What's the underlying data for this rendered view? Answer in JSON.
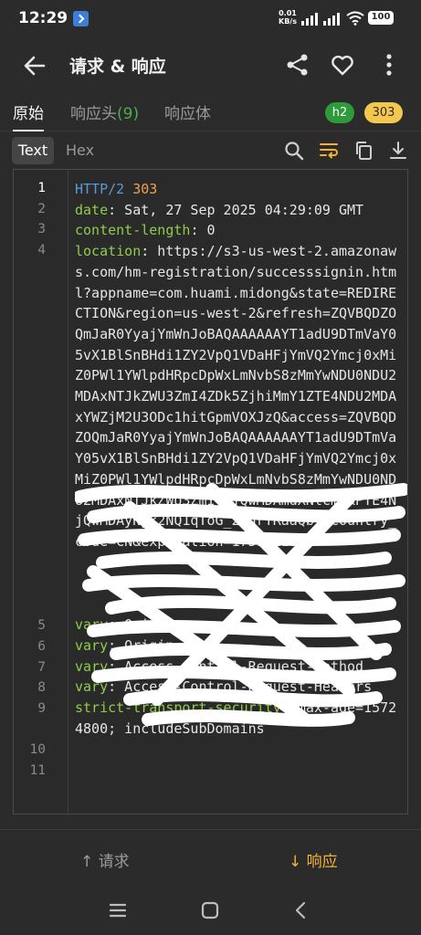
{
  "status": {
    "time": "12:29",
    "net_speed_top": "0.01",
    "net_speed_bottom": "KB/s",
    "battery": "100"
  },
  "app_bar": {
    "title": "请求 & 响应"
  },
  "tabs": {
    "raw": "原始",
    "headers": "响应头",
    "headers_count": "(9)",
    "body": "响应体"
  },
  "badges": {
    "protocol": "h2",
    "status_code": "303"
  },
  "view_modes": {
    "text": "Text",
    "hex": "Hex"
  },
  "code": {
    "line_numbers": [
      "1",
      "2",
      "3",
      "4",
      "5",
      "6",
      "7",
      "8",
      "9",
      "10",
      "11"
    ],
    "line1_protocol": "HTTP/2",
    "line1_status": "303",
    "line2_key": "date",
    "line2_value": " Sat, 27 Sep 2025 04:29:09 GMT",
    "line3_key": "content-length",
    "line3_value": " 0",
    "line4_key": "location",
    "line4_value": " https://s3-us-west-2.amazonaws.com/hm-registration/successsignin.html?appname=com.huami.midong&state=REDIRECTION&region=us-west-2&refresh=ZQVBQDZOQmJaR0YyajYmWnJoBAQAAAAAAYT1adU9DTmVaY05vX1BlSnBHdi1ZY2VpQ1VDaHFjYmVQ2Ymcj0xMiZ0PWl1YWlpdHRpcDpWxLmNvbS8zMmYwNDU0NDU2MDAxNTJkZWU3ZmI4ZDk5ZjhiMmY1ZTE4NDU2MDAxYWZjM2U3ODc1hitGpmVOXJzQ&access=ZQVBQDZOQmJaR0YyajYmWnJoBAQAAAAAAYT1adU9DTmVaY05vX1BlSnBHdi1ZY2VpQ1VDaHFjYmVQ2Ymcj0xMiZ0PWl1YWlpdHRpcDpWxLmNvbS8zMmYwNDU0NDU2MDAxNTJkZWU3ZmI4NjQwMDAmdXNlcmlkPTE4NjQwMDAyNjk2NQ1qToG_2EdrYRaaQbVacountry_code=CN&expiration=1759811349",
    "line5_key": "vary",
    "line5_value": " Origin",
    "line6_key": "vary",
    "line6_value": " Origin",
    "line7_key": "vary",
    "line7_value": " Access-Control-Request-Method",
    "line8_key": "vary",
    "line8_value": " Access-Control-Request-Headers",
    "line9_key": "strict-transport-security",
    "line9_value": " max-age=15724800; includeSubDomains",
    "colon": ":"
  },
  "bottom_nav": {
    "request": "请求",
    "response": "响应"
  },
  "colors": {
    "background": "#2b2b2b",
    "header_key": "#8fcc49",
    "protocol": "#5b9bd5",
    "status": "#f0a050",
    "accent": "#f2b233",
    "badge_h2": "#2e9b3a",
    "badge_303": "#f2c94c"
  },
  "icons": {
    "back": "arrow-left-icon",
    "share": "share-icon",
    "favorite": "heart-outline-icon",
    "more": "more-vertical-icon",
    "search": "search-icon",
    "wrap": "wrap-lines-icon",
    "copy": "copy-icon",
    "download": "download-icon"
  }
}
